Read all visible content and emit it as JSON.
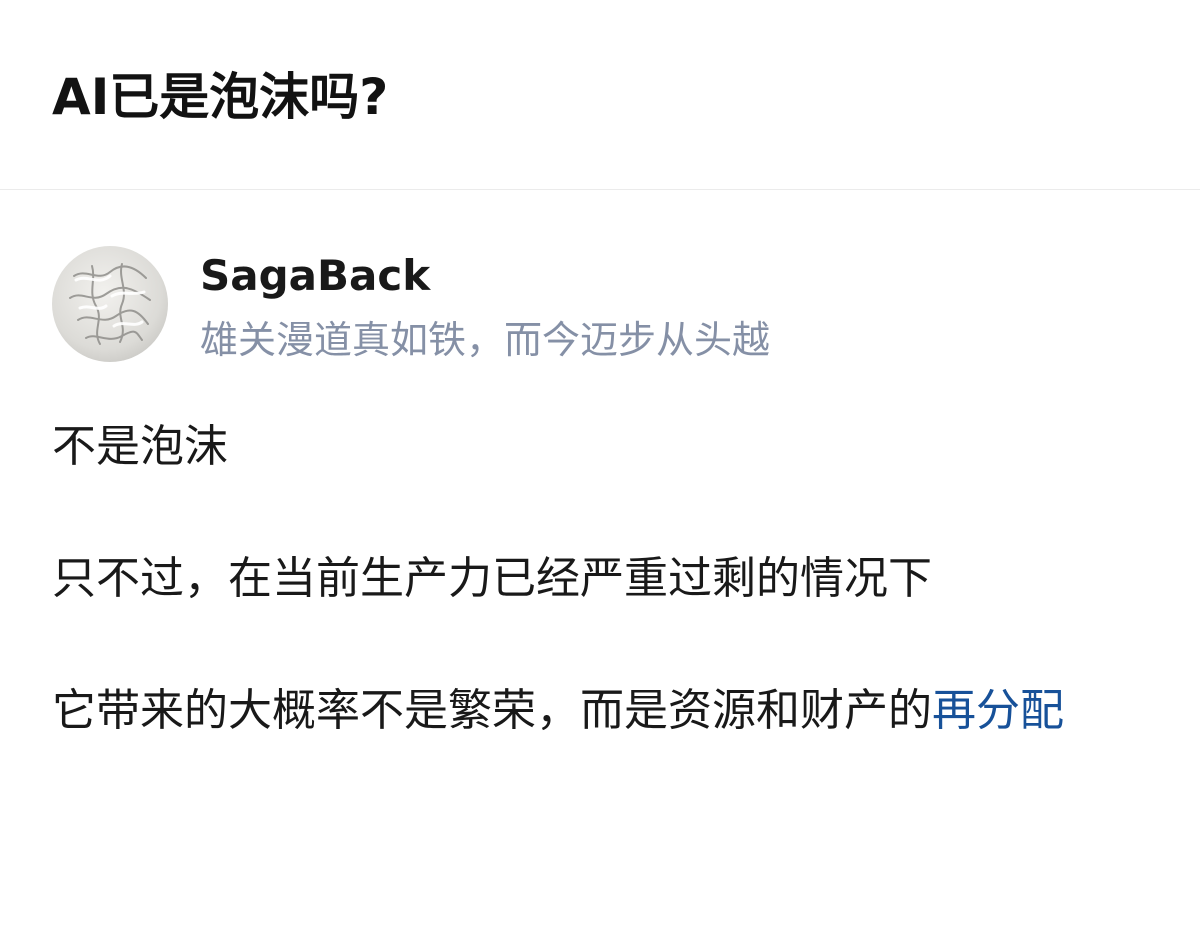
{
  "question": {
    "title": "AI已是泡沫吗?"
  },
  "author": {
    "name": "SagaBack",
    "bio": "雄关漫道真如铁，而今迈步从头越",
    "avatar_icon": "textured-plaster-avatar"
  },
  "answer": {
    "paragraph_1": "不是泡沫",
    "paragraph_2": "只不过，在当前生产力已经严重过剩的情况下",
    "paragraph_3_prefix": "它带来的大概率不是繁荣，而是资源和财产的",
    "paragraph_3_link": "再分配"
  },
  "colors": {
    "text": "#191919",
    "bio": "#8590a6",
    "link": "#175199",
    "divider": "#ebebeb"
  }
}
